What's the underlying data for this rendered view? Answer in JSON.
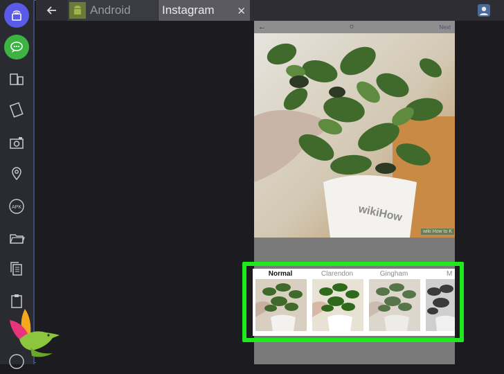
{
  "window": {
    "tabs": [
      {
        "label": "Android",
        "active": false
      },
      {
        "label": "Instagram",
        "active": true
      }
    ],
    "close_glyph": "✕",
    "back_icon": "back-arrow-icon",
    "account_icon": "account-icon"
  },
  "sidebar": {
    "items": [
      {
        "name": "broadcast",
        "icon": "broadcast-icon",
        "color": "#5a5ae8"
      },
      {
        "name": "chat",
        "icon": "chat-bubble-icon",
        "color": "#3db343"
      },
      {
        "name": "multi-screen",
        "icon": "multi-screen-icon"
      },
      {
        "name": "rotate",
        "icon": "rotate-icon"
      },
      {
        "name": "camera",
        "icon": "camera-icon"
      },
      {
        "name": "location",
        "icon": "location-pin-icon"
      },
      {
        "name": "apk",
        "label": "APK",
        "icon": "apk-icon"
      },
      {
        "name": "folder",
        "icon": "folder-icon"
      },
      {
        "name": "copy",
        "icon": "copy-icon"
      },
      {
        "name": "clipboard",
        "icon": "clipboard-icon"
      },
      {
        "name": "help",
        "icon": "help-icon"
      }
    ]
  },
  "phone": {
    "back_glyph": "←",
    "brightness_glyph": "☼",
    "next_label": "Next",
    "watermark": "wiki How to K",
    "pot_text": "wikiHow"
  },
  "filters": [
    {
      "label": "Normal",
      "active": true,
      "tone": "normal"
    },
    {
      "label": "Clarendon",
      "active": false,
      "tone": "clarendon"
    },
    {
      "label": "Gingham",
      "active": false,
      "tone": "gingham"
    },
    {
      "label": "M",
      "active": false,
      "tone": "bw"
    }
  ],
  "colors": {
    "highlight": "#1de91d",
    "sidebar_accent": "#3a4a7a"
  }
}
